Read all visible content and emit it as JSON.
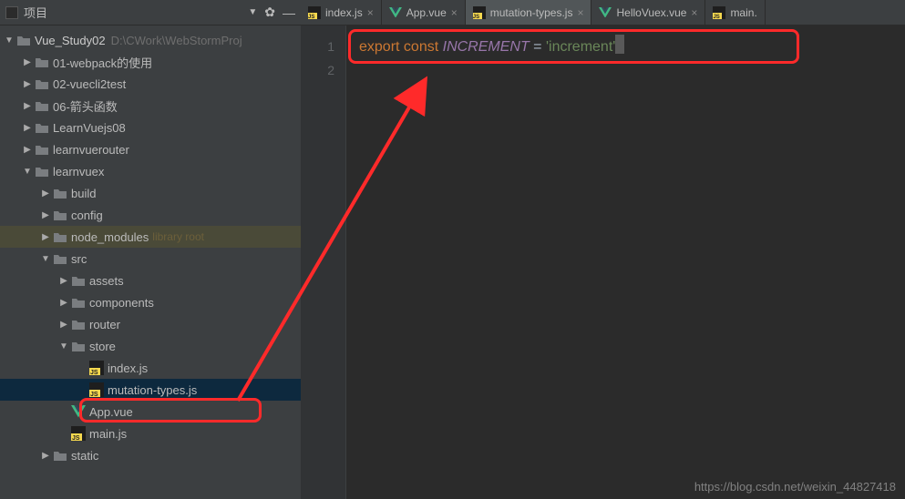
{
  "sidebar": {
    "title": "项目",
    "project": {
      "name": "Vue_Study02",
      "path": "D:\\CWork\\WebStormProj"
    },
    "items": [
      {
        "label": "01-webpack的使用",
        "icon": "folder",
        "depth": 1,
        "twisty": "right"
      },
      {
        "label": "02-vuecli2test",
        "icon": "folder",
        "depth": 1,
        "twisty": "right"
      },
      {
        "label": "06-箭头函数",
        "icon": "folder",
        "depth": 1,
        "twisty": "right"
      },
      {
        "label": "LearnVuejs08",
        "icon": "folder",
        "depth": 1,
        "twisty": "right"
      },
      {
        "label": "learnvuerouter",
        "icon": "folder",
        "depth": 1,
        "twisty": "right"
      },
      {
        "label": "learnvuex",
        "icon": "folder",
        "depth": 1,
        "twisty": "down"
      },
      {
        "label": "build",
        "icon": "folder",
        "depth": 2,
        "twisty": "right"
      },
      {
        "label": "config",
        "icon": "folder",
        "depth": 2,
        "twisty": "right"
      },
      {
        "label": "node_modules",
        "icon": "folder",
        "depth": 2,
        "twisty": "right",
        "suffix": "library root",
        "highlighted": true
      },
      {
        "label": "src",
        "icon": "folder",
        "depth": 2,
        "twisty": "down"
      },
      {
        "label": "assets",
        "icon": "folder",
        "depth": 3,
        "twisty": "right"
      },
      {
        "label": "components",
        "icon": "folder",
        "depth": 3,
        "twisty": "right"
      },
      {
        "label": "router",
        "icon": "folder",
        "depth": 3,
        "twisty": "right"
      },
      {
        "label": "store",
        "icon": "folder",
        "depth": 3,
        "twisty": "down"
      },
      {
        "label": "index.js",
        "icon": "js",
        "depth": 4,
        "twisty": ""
      },
      {
        "label": "mutation-types.js",
        "icon": "js",
        "depth": 4,
        "twisty": "",
        "selected": true
      },
      {
        "label": "App.vue",
        "icon": "vue",
        "depth": 3,
        "twisty": ""
      },
      {
        "label": "main.js",
        "icon": "js",
        "depth": 3,
        "twisty": ""
      },
      {
        "label": "static",
        "icon": "folder",
        "depth": 2,
        "twisty": "right"
      }
    ]
  },
  "tabs": [
    {
      "label": "index.js",
      "icon": "js"
    },
    {
      "label": "App.vue",
      "icon": "vue"
    },
    {
      "label": "mutation-types.js",
      "icon": "js",
      "active": true
    },
    {
      "label": "HelloVuex.vue",
      "icon": "vue"
    },
    {
      "label": "main.",
      "icon": "js",
      "noclose": true
    }
  ],
  "code": {
    "line1": {
      "kw1": "export",
      "kw2": "const",
      "name": "INCREMENT",
      "eq": " = ",
      "str": "'increment'"
    },
    "gutter": [
      "1",
      "2"
    ]
  },
  "watermark": "https://blog.csdn.net/weixin_44827418",
  "glyphs": {
    "twisty_right": "▶",
    "twisty_down": "▼",
    "close": "×",
    "gear": "✿",
    "minimize": "—",
    "dd": "▼"
  }
}
